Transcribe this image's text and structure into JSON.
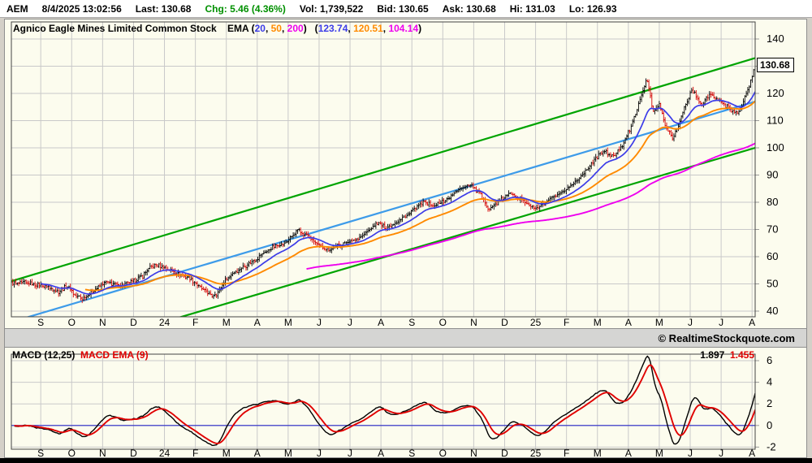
{
  "quote_bar": {
    "symbol": "AEM",
    "timestamp": "8/4/2025 13:02:56",
    "items": [
      {
        "label": "Last:",
        "value": "130.68",
        "color": "#000000"
      },
      {
        "label": "Chg:",
        "value": "5.46 (4.36%)",
        "color": "#009000"
      },
      {
        "label": "Vol:",
        "value": "1,739,522",
        "color": "#000000"
      },
      {
        "label": "Bid:",
        "value": "130.65",
        "color": "#000000"
      },
      {
        "label": "Ask:",
        "value": "130.68",
        "color": "#000000"
      },
      {
        "label": "Hi:",
        "value": "131.03",
        "color": "#000000"
      },
      {
        "label": "Lo:",
        "value": "126.93",
        "color": "#000000"
      }
    ]
  },
  "main_chart": {
    "title_parts": [
      {
        "t": "Agnico Eagle Mines Limited Common Stock",
        "c": "#000000"
      },
      {
        "t": "    EMA (",
        "c": "#000000"
      },
      {
        "t": "20",
        "c": "#3C3CE8"
      },
      {
        "t": ", ",
        "c": "#000000"
      },
      {
        "t": "50",
        "c": "#FF8A00"
      },
      {
        "t": ", ",
        "c": "#000000"
      },
      {
        "t": "200",
        "c": "#EE00EE"
      },
      {
        "t": ")   (",
        "c": "#000000"
      },
      {
        "t": "123.74",
        "c": "#3C3CE8"
      },
      {
        "t": ", ",
        "c": "#000000"
      },
      {
        "t": "120.51",
        "c": "#FF8A00"
      },
      {
        "t": ", ",
        "c": "#000000"
      },
      {
        "t": "104.14",
        "c": "#EE00EE"
      },
      {
        "t": ")",
        "c": "#000000"
      }
    ],
    "last_price_label": "130.68"
  },
  "watermark": {
    "text": "© RealtimeStockquote.com"
  },
  "macd_panel": {
    "legend_parts": [
      {
        "t": "MACD (12,25)  ",
        "c": "#000000"
      },
      {
        "t": "MACD EMA (9)",
        "c": "#E00000"
      }
    ],
    "value_parts": [
      {
        "t": "1.897  ",
        "c": "#000000"
      },
      {
        "t": "1.455",
        "c": "#E00000"
      }
    ]
  },
  "chart_data": [
    {
      "type": "ohlc",
      "name": "price-chart",
      "symbol": "AEM",
      "title": "Agnico Eagle Mines Limited Common Stock",
      "x_axis": {
        "labels": [
          "S",
          "O",
          "N",
          "D",
          "24",
          "F",
          "M",
          "A",
          "M",
          "J",
          "J",
          "A",
          "S",
          "O",
          "N",
          "D",
          "25",
          "F",
          "M",
          "A",
          "M",
          "J",
          "J",
          "A"
        ],
        "note": "monthly ticks, Sep 2023 - Aug 2025"
      },
      "y_axis": {
        "ticks": [
          140,
          130,
          120,
          110,
          100,
          90,
          80,
          70,
          60,
          50,
          40
        ],
        "range": [
          38,
          146
        ]
      },
      "domain_months": [
        -0.95,
        23.1
      ],
      "bar_count": 505,
      "up_color": "#000000",
      "down_color": "#D40000",
      "grid_color": "#C9C9C9",
      "background": "#FCFCEE",
      "close_keyframes": [
        [
          -0.95,
          50
        ],
        [
          -0.5,
          50.5
        ],
        [
          0.2,
          49
        ],
        [
          0.55,
          47
        ],
        [
          0.85,
          49.5
        ],
        [
          1.1,
          46
        ],
        [
          1.35,
          44.5
        ],
        [
          1.8,
          48.5
        ],
        [
          2.1,
          50.5
        ],
        [
          2.5,
          49.5
        ],
        [
          2.9,
          50.5
        ],
        [
          3.3,
          53
        ],
        [
          3.55,
          56
        ],
        [
          3.8,
          57
        ],
        [
          4.3,
          54.5
        ],
        [
          4.7,
          52.5
        ],
        [
          5.0,
          50.5
        ],
        [
          5.3,
          47.5
        ],
        [
          5.55,
          45.5
        ],
        [
          5.75,
          47
        ],
        [
          6.0,
          52
        ],
        [
          6.3,
          54.5
        ],
        [
          6.6,
          56.5
        ],
        [
          7.0,
          59.5
        ],
        [
          7.5,
          63.5
        ],
        [
          7.9,
          65
        ],
        [
          8.3,
          69.5
        ],
        [
          8.6,
          68
        ],
        [
          9.0,
          64
        ],
        [
          9.3,
          62.5
        ],
        [
          9.7,
          64.5
        ],
        [
          10.1,
          66
        ],
        [
          10.5,
          68.5
        ],
        [
          10.9,
          72.5
        ],
        [
          11.2,
          70.5
        ],
        [
          11.6,
          73.5
        ],
        [
          12.0,
          76.5
        ],
        [
          12.4,
          80.5
        ],
        [
          12.7,
          78.5
        ],
        [
          13.1,
          81
        ],
        [
          13.6,
          85.5
        ],
        [
          13.9,
          86.5
        ],
        [
          14.2,
          83
        ],
        [
          14.5,
          77.5
        ],
        [
          14.9,
          81
        ],
        [
          15.2,
          83.5
        ],
        [
          15.6,
          80.5
        ],
        [
          16.0,
          77.5
        ],
        [
          16.4,
          80.5
        ],
        [
          16.8,
          83
        ],
        [
          17.1,
          85.5
        ],
        [
          17.5,
          90
        ],
        [
          17.9,
          95.5
        ],
        [
          18.2,
          99
        ],
        [
          18.5,
          96.5
        ],
        [
          18.8,
          101
        ],
        [
          19.1,
          108
        ],
        [
          19.3,
          115
        ],
        [
          19.45,
          120
        ],
        [
          19.6,
          126
        ],
        [
          19.8,
          113
        ],
        [
          20.0,
          116
        ],
        [
          20.2,
          108
        ],
        [
          20.45,
          103.5
        ],
        [
          20.8,
          114
        ],
        [
          21.05,
          121.5
        ],
        [
          21.35,
          116
        ],
        [
          21.65,
          119.5
        ],
        [
          22.0,
          117
        ],
        [
          22.3,
          114
        ],
        [
          22.55,
          112.5
        ],
        [
          22.75,
          118
        ],
        [
          22.9,
          122.5
        ],
        [
          23.0,
          126.5
        ],
        [
          23.1,
          130.68
        ]
      ],
      "last_bar": {
        "high": 131.03,
        "low": 126.93,
        "close": 130.68
      },
      "emas": [
        {
          "period": 20,
          "color": "#3C3CE8",
          "last_value": 123.74
        },
        {
          "period": 50,
          "color": "#FF8A00",
          "last_value": 120.51
        },
        {
          "period": 200,
          "color": "#EE00EE",
          "last_value": 104.14
        }
      ],
      "trendlines": [
        {
          "name": "upper-channel",
          "color": "#00A400",
          "from": [
            -0.95,
            51
          ],
          "to": [
            23.1,
            133
          ]
        },
        {
          "name": "mid-channel",
          "color": "#3D9BE9",
          "from": [
            -0.95,
            36
          ],
          "to": [
            23.1,
            117
          ]
        },
        {
          "name": "lower-channel",
          "color": "#00A400",
          "from": [
            -0.95,
            19.5
          ],
          "to": [
            23.1,
            100
          ]
        }
      ],
      "last_price": 130.68
    },
    {
      "type": "line",
      "name": "macd",
      "params": {
        "fast": 12,
        "slow": 25,
        "signal": 9
      },
      "y_axis": {
        "ticks": [
          6,
          4,
          2,
          0,
          -2
        ],
        "range": [
          -2.3,
          6.6
        ]
      },
      "series": [
        {
          "name": "MACD (12,25)",
          "color": "#000000",
          "last_value": 1.897
        },
        {
          "name": "MACD EMA (9)",
          "color": "#E00000",
          "last_value": 1.455
        }
      ],
      "zero_line_color": "#2929C8",
      "grid_color": "#C9C9C9"
    }
  ]
}
